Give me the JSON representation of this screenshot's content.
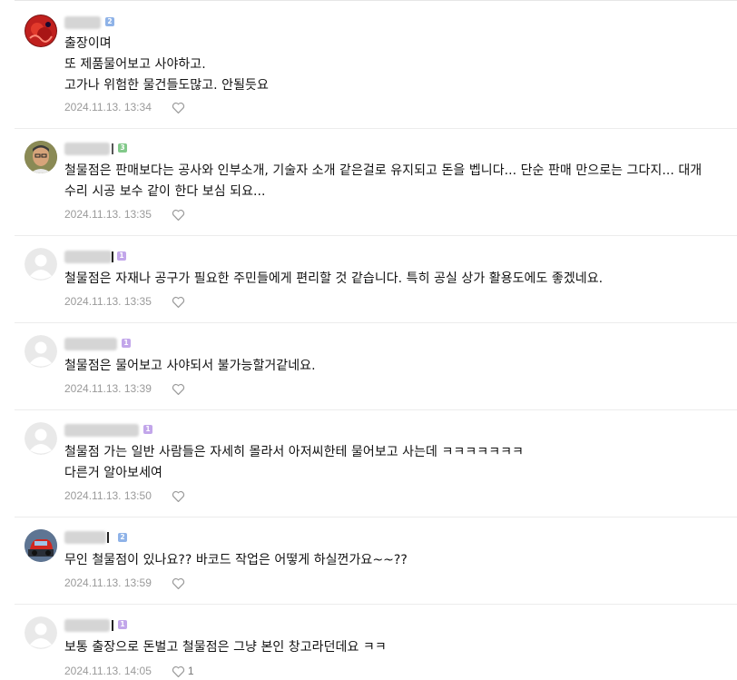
{
  "comments": [
    {
      "badge": "2",
      "lines": [
        "출장이며",
        "또 제품물어보고 사야하고.",
        "고가나 위험한 물건들도많고. 안될듯요"
      ],
      "date": "2024.11.13. 13:34",
      "likes": ""
    },
    {
      "badge": "3",
      "lines": [
        "철물점은 판매보다는 공사와 인부소개, 기술자 소개 같은걸로 유지되고 돈을 벱니다... 단순 판매 만으로는 그다지... 대개 수리 시공 보수 같이 한다 보심 되요..."
      ],
      "date": "2024.11.13. 13:35",
      "likes": ""
    },
    {
      "badge": "1",
      "lines": [
        "철물점은 자재나 공구가 필요한 주민들에게 편리할 것 같습니다. 특히 공실 상가 활용도에도 좋겠네요."
      ],
      "date": "2024.11.13. 13:35",
      "likes": ""
    },
    {
      "badge": "1",
      "lines": [
        "철물점은 물어보고 사야되서 불가능할거같네요."
      ],
      "date": "2024.11.13. 13:39",
      "likes": ""
    },
    {
      "badge": "1",
      "lines": [
        "철물점 가는 일반 사람들은 자세히 몰라서 아저씨한테 물어보고 사는데 ㅋㅋㅋㅋㅋㅋㅋ",
        "다른거 알아보세여"
      ],
      "date": "2024.11.13. 13:50",
      "likes": ""
    },
    {
      "badge": "2",
      "lines": [
        "무인 철물점이 있나요?? 바코드 작업은 어떻게 하실껀가요~~??"
      ],
      "date": "2024.11.13. 13:59",
      "likes": ""
    },
    {
      "badge": "1",
      "lines": [
        "보통 출장으로 돈벌고 철물점은 그냥 본인 창고라던데요 ㅋㅋ"
      ],
      "date": "2024.11.13. 14:05",
      "likes": "1"
    }
  ],
  "icons": {
    "like": "heart-outline-icon",
    "avatar_default": "default-avatar-icon"
  },
  "colors": {
    "level1": "#c2a6ea",
    "level2": "#8fb3e8",
    "level3": "#82c98a",
    "meta": "#9a9a9a"
  }
}
